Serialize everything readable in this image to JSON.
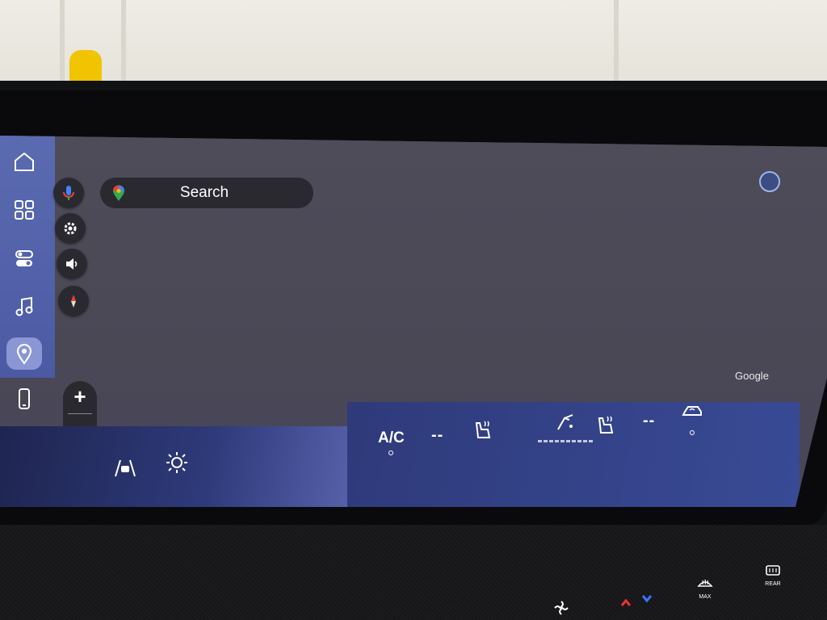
{
  "search": {
    "label": "Search"
  },
  "map": {
    "attribution": "Google"
  },
  "zoom": {
    "in_label": "+",
    "out_label": "−"
  },
  "rail": {
    "items": [
      {
        "name": "home",
        "icon": "home-icon"
      },
      {
        "name": "apps",
        "icon": "grid-icon"
      },
      {
        "name": "controls",
        "icon": "toggle-icon"
      },
      {
        "name": "media",
        "icon": "music-note-icon"
      },
      {
        "name": "navigation",
        "icon": "location-pin-icon",
        "active": true
      },
      {
        "name": "phone",
        "icon": "phone-icon"
      }
    ]
  },
  "floating_buttons": [
    "microphone-icon",
    "settings-icon",
    "volume-icon",
    "compass-icon"
  ],
  "climate": {
    "ac_label": "A/C",
    "left_temp": "--",
    "right_temp": "--"
  },
  "hardware_buttons": {
    "max_defrost_label": "MAX",
    "rear_defrost_label": "REAR"
  },
  "colors": {
    "rail": "#5b6bb0",
    "map_background": "#4b4a57",
    "climate_bar": "#2e3a7a",
    "fab_background": "#2a2930"
  }
}
